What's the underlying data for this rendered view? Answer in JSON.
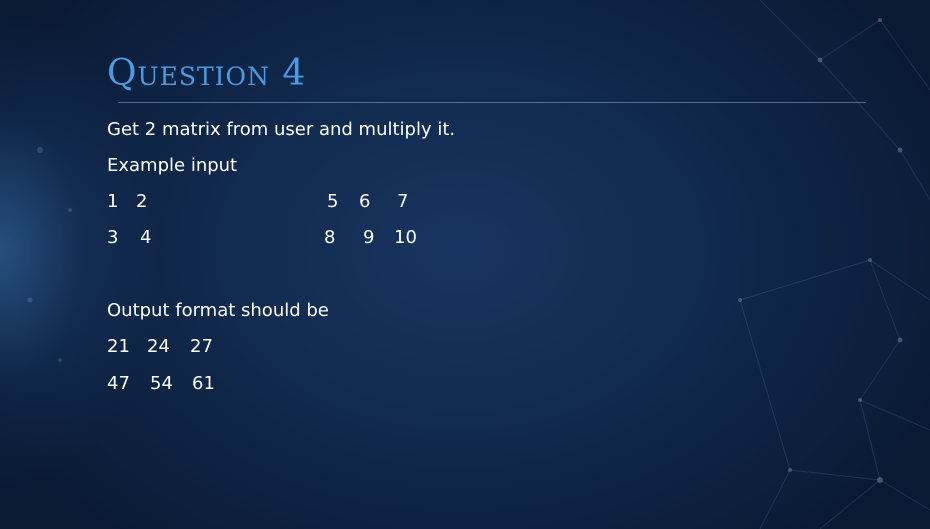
{
  "title": "Question 4",
  "lines": {
    "instruction": "Get 2 matrix from user and multiply it.",
    "example_label": "Example input",
    "output_label": "Output format should be"
  },
  "matrix_a": [
    [
      "1",
      "2"
    ],
    [
      "3",
      "4"
    ]
  ],
  "matrix_b": [
    [
      "5",
      "6",
      "7"
    ],
    [
      "8",
      "9",
      "10"
    ]
  ],
  "output_matrix": [
    [
      "21",
      "24",
      "27"
    ],
    [
      "47",
      "54",
      "61"
    ]
  ],
  "colors": {
    "background": "#0d213f",
    "title": "#4b9be4",
    "text": "#ffffff"
  }
}
